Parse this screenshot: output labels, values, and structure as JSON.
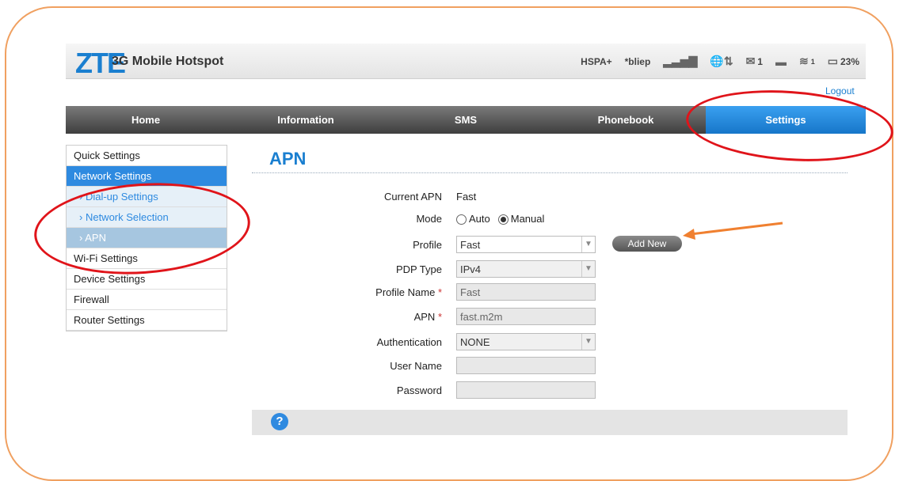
{
  "header": {
    "logo": "ZTE",
    "product": "3G Mobile Hotspot",
    "network_type": "HSPA+",
    "operator": "*bliep",
    "sms_count": "1",
    "wifi_clients": "1",
    "battery": "23%",
    "logout": "Logout"
  },
  "nav": [
    "Home",
    "Information",
    "SMS",
    "Phonebook",
    "Settings"
  ],
  "sidebar": {
    "quick": "Quick Settings",
    "network": "Network Settings",
    "dialup": "Dial-up Settings",
    "network_selection": "Network Selection",
    "apn": "APN",
    "wifi": "Wi-Fi Settings",
    "device": "Device Settings",
    "firewall": "Firewall",
    "router": "Router Settings"
  },
  "page": {
    "title": "APN",
    "current_apn_label": "Current APN",
    "current_apn": "Fast",
    "mode_label": "Mode",
    "mode_auto": "Auto",
    "mode_manual": "Manual",
    "profile_label": "Profile",
    "profile": "Fast",
    "add_new": "Add New",
    "pdp_label": "PDP Type",
    "pdp": "IPv4",
    "profile_name_label": "Profile Name",
    "profile_name": "Fast",
    "apn_label": "APN",
    "apn": "fast.m2m",
    "auth_label": "Authentication",
    "auth": "NONE",
    "user_label": "User Name",
    "password_label": "Password",
    "required_mark": "*"
  },
  "footer": {
    "help": "?"
  },
  "colors": {
    "accent": "#1a7fd0",
    "annotation": "#e0141a",
    "arrow": "#f08030"
  }
}
